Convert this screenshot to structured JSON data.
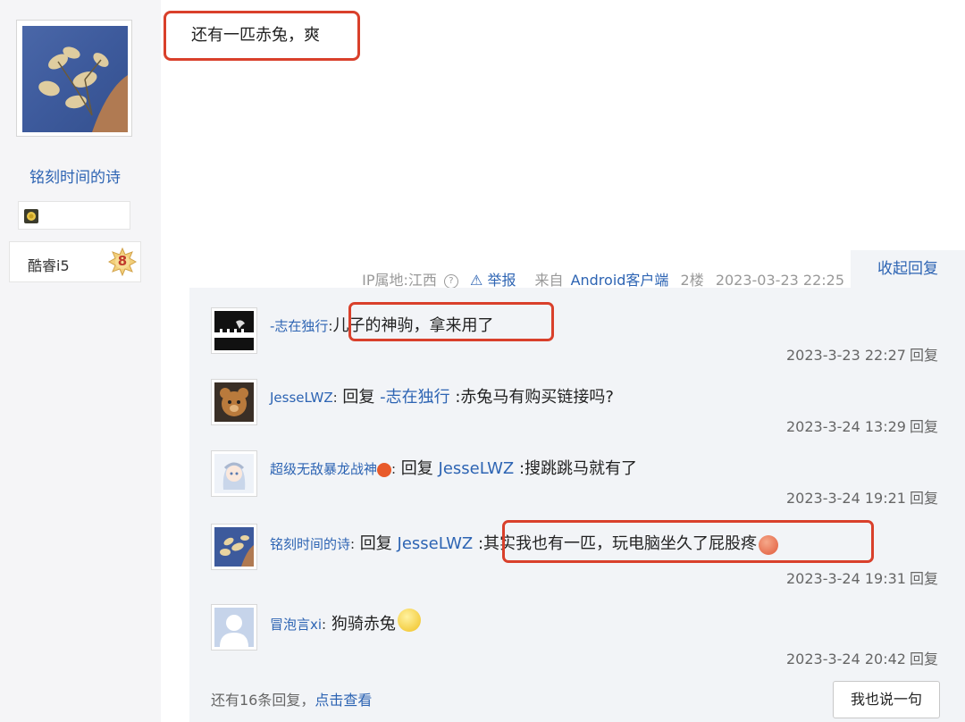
{
  "author": {
    "name": "铭刻时间的诗",
    "device": "酷睿i5",
    "level": "8"
  },
  "post": {
    "text": "还有一匹赤兔，爽"
  },
  "meta": {
    "ip": "IP属地:江西",
    "help": "?",
    "report": "⚠ 举报",
    "from_prefix": "来自",
    "client": "Android客户端",
    "floor": "2楼",
    "datetime": "2023-03-23 22:25",
    "collapse": "收起回复"
  },
  "replies": [
    {
      "user": "-志在独行",
      "separator": ":",
      "prefix": "",
      "target": "",
      "text": "儿子的神驹，拿来用了",
      "time": "2023-3-23 22:27",
      "reply_label": "回复"
    },
    {
      "user": "JesseLWZ",
      "separator": ":",
      "prefix": " 回复 ",
      "target": "-志在独行",
      "text": " :赤兔马有购买链接吗?",
      "time": "2023-3-24 13:29",
      "reply_label": "回复"
    },
    {
      "user": "超级无敌暴龙战神",
      "separator": ":",
      "prefix": " 回复 ",
      "target": "JesseLWZ",
      "text": " :搜跳跳马就有了",
      "time": "2023-3-24 19:21",
      "reply_label": "回复"
    },
    {
      "user": "铭刻时间的诗",
      "separator": ":",
      "prefix": " 回复 ",
      "target": "JesseLWZ",
      "text": " :其实我也有一匹，玩电脑坐久了屁股疼",
      "time": "2023-3-24 19:31",
      "reply_label": "回复"
    },
    {
      "user": "冒泡言xi",
      "separator": ":",
      "prefix": " ",
      "target": "",
      "text": "狗骑赤兔",
      "time": "2023-3-24 20:42",
      "reply_label": "回复"
    }
  ],
  "footer": {
    "more_prefix": "还有16条回复，",
    "more_link": "点击查看",
    "say_button": "我也说一句"
  }
}
